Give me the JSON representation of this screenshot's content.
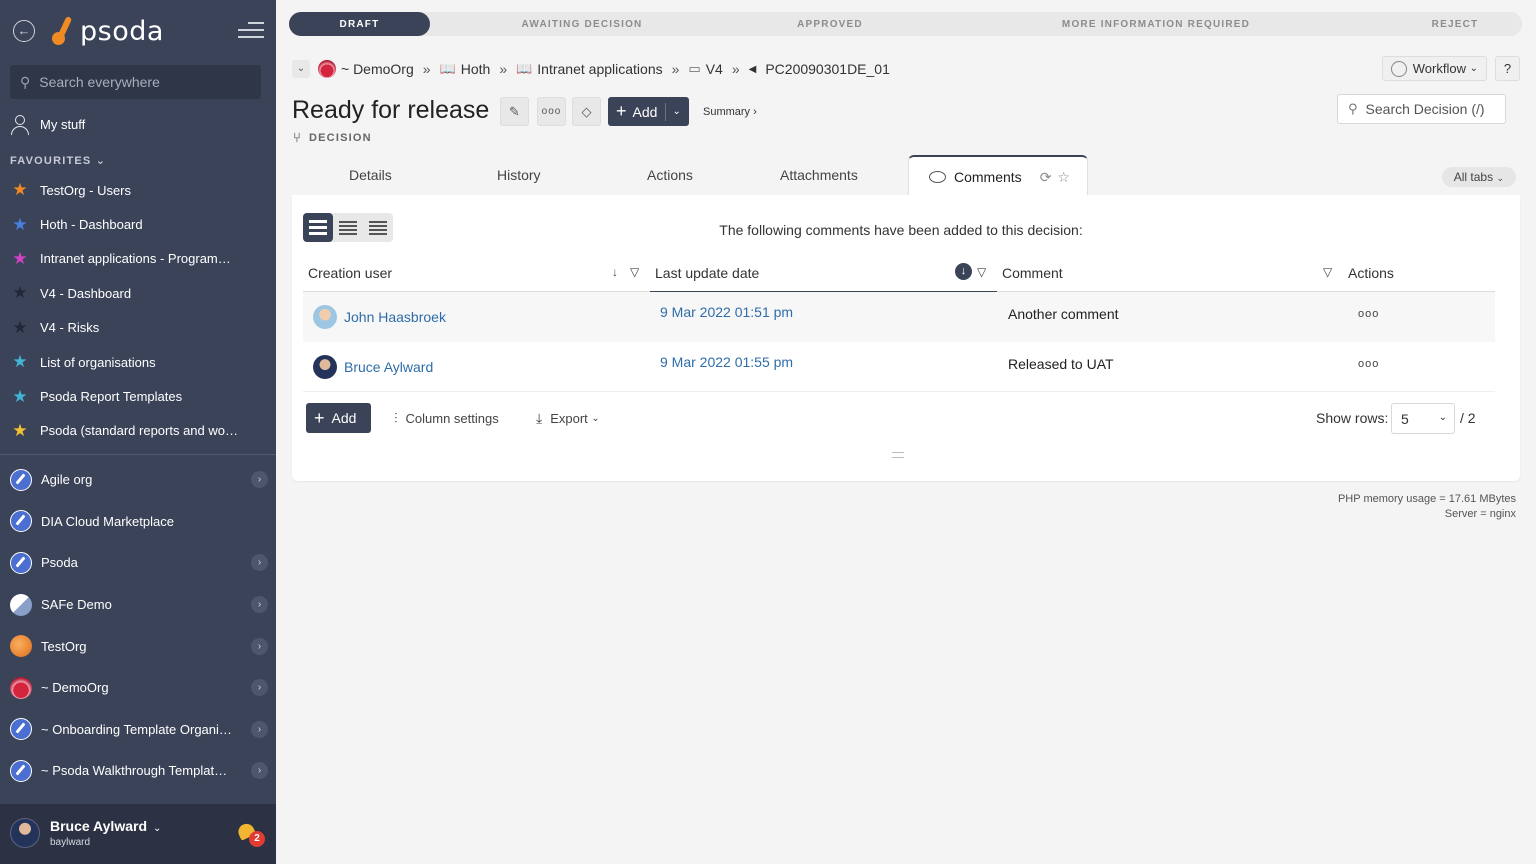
{
  "sidebar": {
    "logo_text": "psoda",
    "search_placeholder": "Search everywhere",
    "my_stuff": "My stuff",
    "favourites_label": "FAVOURITES",
    "favourites": [
      {
        "label": "TestOrg - Users",
        "color": "#f08a24"
      },
      {
        "label": "Hoth - Dashboard",
        "color": "#4a7fe0"
      },
      {
        "label": "Intranet applications - Programme...",
        "color": "#d042c8"
      },
      {
        "label": "V4 - Dashboard",
        "color": "#2f3647"
      },
      {
        "label": "V4 - Risks",
        "color": "#2f3647"
      },
      {
        "label": "List of organisations",
        "color": "#42b4d6"
      },
      {
        "label": "Psoda Report Templates",
        "color": "#42b4d6"
      },
      {
        "label": "Psoda (standard reports and work...",
        "color": "#f2c230"
      }
    ],
    "orgs": [
      {
        "label": "Agile org",
        "icon": "compass",
        "chevron": true
      },
      {
        "label": "DIA Cloud Marketplace",
        "icon": "compass",
        "chevron": false
      },
      {
        "label": "Psoda",
        "icon": "compass",
        "chevron": true
      },
      {
        "label": "SAFe Demo",
        "icon": "safe",
        "chevron": true
      },
      {
        "label": "TestOrg",
        "icon": "test",
        "chevron": true
      },
      {
        "label": "~ DemoOrg",
        "icon": "demo",
        "chevron": true
      },
      {
        "label": "~ Onboarding Template Organisa...",
        "icon": "compass",
        "chevron": true
      },
      {
        "label": "~ Psoda Walkthrough Template P...",
        "icon": "compass",
        "chevron": true
      }
    ],
    "user": {
      "name": "Bruce Aylward",
      "login": "baylward",
      "notifications": "2"
    }
  },
  "workflow": {
    "steps": [
      {
        "label": "DRAFT",
        "active": true
      },
      {
        "label": "AWAITING DECISION",
        "active": false
      },
      {
        "label": "APPROVED",
        "active": false
      },
      {
        "label": "MORE INFORMATION REQUIRED",
        "active": false
      },
      {
        "label": "REJECT",
        "active": false
      }
    ]
  },
  "breadcrumb": {
    "items": [
      "~ DemoOrg",
      "Hoth",
      "Intranet applications",
      "V4"
    ],
    "current": "PC20090301DE_01"
  },
  "toolbar": {
    "workflow_label": "Workflow",
    "help_label": "?"
  },
  "header": {
    "title": "Ready for release",
    "add_label": "Add",
    "summary_label": "Summary ›",
    "type_label": "DECISION",
    "search_placeholder": "Search Decision (/)"
  },
  "tabs": {
    "items": [
      "Details",
      "History",
      "Actions",
      "Attachments"
    ],
    "active": "Comments",
    "all_tabs": "All tabs"
  },
  "comments": {
    "intro": "The following comments have been added to this decision:",
    "columns": {
      "creation_user": "Creation user",
      "last_update": "Last update date",
      "comment": "Comment",
      "actions": "Actions"
    },
    "rows": [
      {
        "user": "John Haasbroek",
        "date": "9 Mar 2022 01:51 pm",
        "comment": "Another comment",
        "more": "ooo"
      },
      {
        "user": "Bruce Aylward",
        "date": "9 Mar 2022 01:55 pm",
        "comment": "Released to UAT",
        "more": "ooo"
      }
    ],
    "add_label": "Add",
    "column_settings": "Column settings",
    "export_label": "Export",
    "show_rows_label": "Show rows:",
    "show_rows_value": "5",
    "pages": "/ 2"
  },
  "footer": {
    "memory": "PHP memory usage = 17.61 MBytes",
    "server": "Server = nginx"
  }
}
